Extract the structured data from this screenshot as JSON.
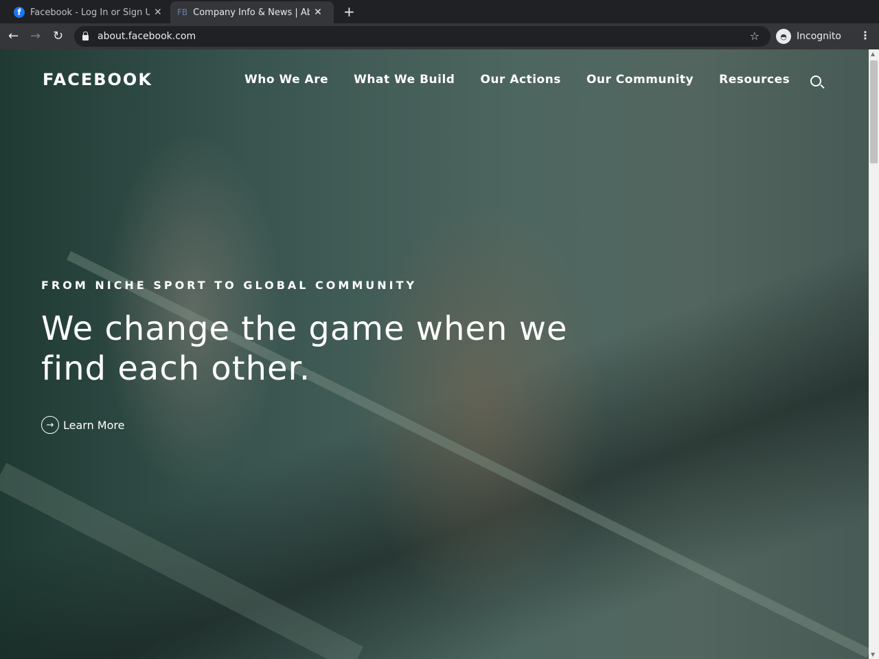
{
  "browser": {
    "tabs": [
      {
        "title": "Facebook - Log In or Sign Up",
        "active": false
      },
      {
        "title": "Company Info & News | About Facebook",
        "active": true
      }
    ],
    "url": "about.facebook.com",
    "profile": "Incognito"
  },
  "site": {
    "logo": "FACEBOOK",
    "nav": [
      "Who We Are",
      "What We Build",
      "Our Actions",
      "Our Community",
      "Resources"
    ],
    "hero": {
      "eyebrow": "FROM NICHE SPORT TO GLOBAL COMMUNITY",
      "headline": "We change the game when we find each other.",
      "cta": "Learn More"
    }
  }
}
